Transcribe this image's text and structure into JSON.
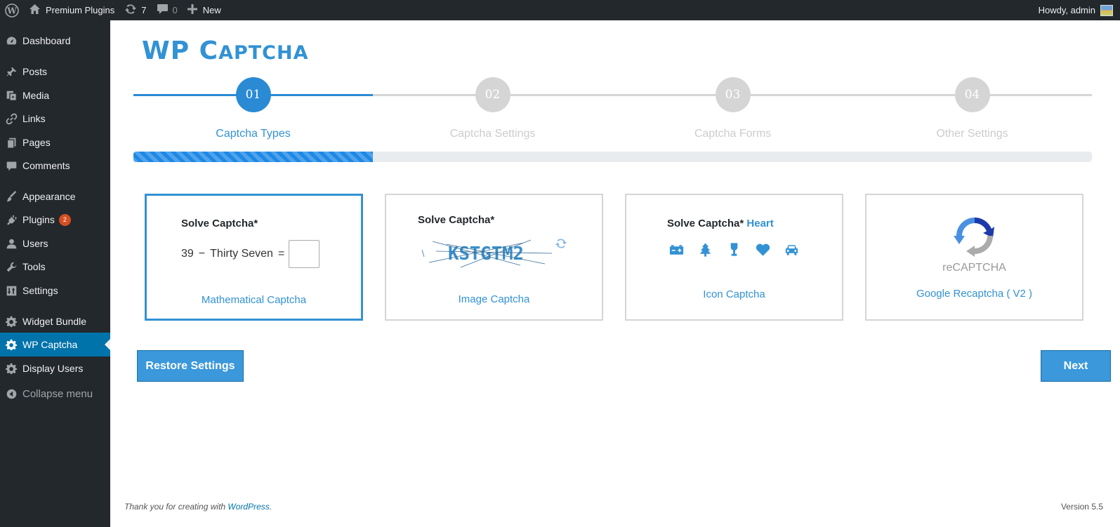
{
  "adminbar": {
    "wp_icon": "wordpress-logo-icon",
    "site_name": "Premium Plugins",
    "updates_count": "7",
    "comments_count": "0",
    "new_label": "New",
    "greeting": "Howdy, admin"
  },
  "sidebar": {
    "items": [
      {
        "label": "Dashboard",
        "icon": "dashboard-icon"
      },
      {
        "label": "Posts",
        "icon": "pin-icon"
      },
      {
        "label": "Media",
        "icon": "media-icon"
      },
      {
        "label": "Links",
        "icon": "link-icon"
      },
      {
        "label": "Pages",
        "icon": "pages-icon"
      },
      {
        "label": "Comments",
        "icon": "comment-icon"
      },
      {
        "label": "Appearance",
        "icon": "brush-icon"
      },
      {
        "label": "Plugins",
        "icon": "plugin-icon",
        "badge": "2"
      },
      {
        "label": "Users",
        "icon": "user-icon"
      },
      {
        "label": "Tools",
        "icon": "wrench-icon"
      },
      {
        "label": "Settings",
        "icon": "settings-icon"
      },
      {
        "label": "Widget Bundle",
        "icon": "gear-icon"
      },
      {
        "label": "WP Captcha",
        "icon": "gear-icon",
        "current": true
      },
      {
        "label": "Display Users",
        "icon": "gear-icon"
      },
      {
        "label": "Collapse menu",
        "icon": "collapse-arrow-icon"
      }
    ]
  },
  "page": {
    "title_first": "WP",
    "title_second_initial": "C",
    "title_second_rest": "APTCHA"
  },
  "steps": [
    {
      "number": "01",
      "label": "Captcha Types",
      "active": true
    },
    {
      "number": "02",
      "label": "Captcha Settings",
      "active": false
    },
    {
      "number": "03",
      "label": "Captcha Forms",
      "active": false
    },
    {
      "number": "04",
      "label": "Other Settings",
      "active": false
    }
  ],
  "progress": {
    "fraction": 0.25,
    "color": "#1e88e5"
  },
  "cards": {
    "math": {
      "title": "Solve Captcha*",
      "operand_a": "39",
      "operator": "−",
      "operand_b": "Thirty Seven",
      "equals": "=",
      "label": "Mathematical Captcha",
      "selected": true
    },
    "image": {
      "title": "Solve Captcha*",
      "captcha_text": "KSTGTM2",
      "label": "Image Captcha"
    },
    "icon": {
      "title": "Solve Captcha*",
      "target": "Heart",
      "icons": [
        "battery-icon",
        "tree-icon",
        "wine-glass-icon",
        "heart-icon",
        "car-icon"
      ],
      "label": "Icon Captcha"
    },
    "recaptcha": {
      "logo_text": "reCAPTCHA",
      "label": "Google Recaptcha ( V2 )"
    }
  },
  "buttons": {
    "restore": "Restore Settings",
    "next": "Next"
  },
  "footer": {
    "thanks_prefix": "Thank you for creating with ",
    "wp_link": "WordPress",
    "thanks_suffix": ".",
    "version": "Version 5.5"
  },
  "colors": {
    "accent": "#3292d4",
    "admin_dark": "#23282d",
    "current_menu": "#0073aa",
    "inactive_step": "#d5d5d5"
  }
}
